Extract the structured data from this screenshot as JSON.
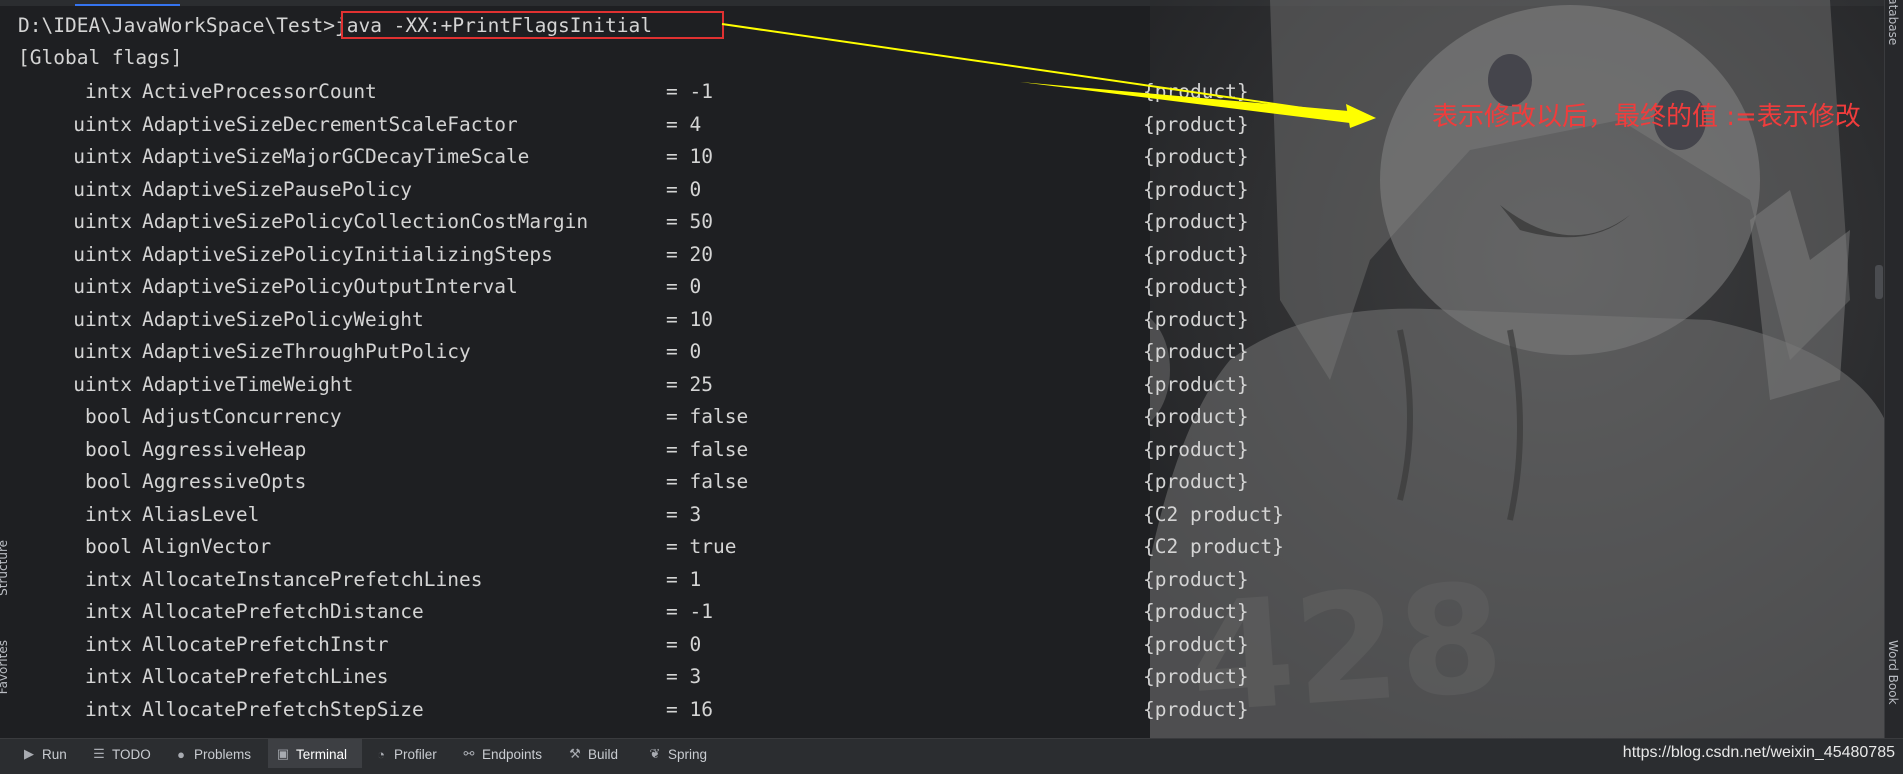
{
  "terminal": {
    "prompt": "D:\\IDEA\\JavaWorkSpace\\Test>",
    "command": "java -XX:+PrintFlagsInitial",
    "header": "[Global flags]",
    "flags": [
      {
        "type": "intx",
        "name": "ActiveProcessorCount",
        "value": "-1",
        "origin": "{product}"
      },
      {
        "type": "uintx",
        "name": "AdaptiveSizeDecrementScaleFactor",
        "value": "4",
        "origin": "{product}"
      },
      {
        "type": "uintx",
        "name": "AdaptiveSizeMajorGCDecayTimeScale",
        "value": "10",
        "origin": "{product}"
      },
      {
        "type": "uintx",
        "name": "AdaptiveSizePausePolicy",
        "value": "0",
        "origin": "{product}"
      },
      {
        "type": "uintx",
        "name": "AdaptiveSizePolicyCollectionCostMargin",
        "value": "50",
        "origin": "{product}"
      },
      {
        "type": "uintx",
        "name": "AdaptiveSizePolicyInitializingSteps",
        "value": "20",
        "origin": "{product}"
      },
      {
        "type": "uintx",
        "name": "AdaptiveSizePolicyOutputInterval",
        "value": "0",
        "origin": "{product}"
      },
      {
        "type": "uintx",
        "name": "AdaptiveSizePolicyWeight",
        "value": "10",
        "origin": "{product}"
      },
      {
        "type": "uintx",
        "name": "AdaptiveSizeThroughPutPolicy",
        "value": "0",
        "origin": "{product}"
      },
      {
        "type": "uintx",
        "name": "AdaptiveTimeWeight",
        "value": "25",
        "origin": "{product}"
      },
      {
        "type": "bool",
        "name": "AdjustConcurrency",
        "value": "false",
        "origin": "{product}"
      },
      {
        "type": "bool",
        "name": "AggressiveHeap",
        "value": "false",
        "origin": "{product}"
      },
      {
        "type": "bool",
        "name": "AggressiveOpts",
        "value": "false",
        "origin": "{product}"
      },
      {
        "type": "intx",
        "name": "AliasLevel",
        "value": "3",
        "origin": "{C2 product}"
      },
      {
        "type": "bool",
        "name": "AlignVector",
        "value": "true",
        "origin": "{C2 product}"
      },
      {
        "type": "intx",
        "name": "AllocateInstancePrefetchLines",
        "value": "1",
        "origin": "{product}"
      },
      {
        "type": "intx",
        "name": "AllocatePrefetchDistance",
        "value": "-1",
        "origin": "{product}"
      },
      {
        "type": "intx",
        "name": "AllocatePrefetchInstr",
        "value": "0",
        "origin": "{product}"
      },
      {
        "type": "intx",
        "name": "AllocatePrefetchLines",
        "value": "3",
        "origin": "{product}"
      },
      {
        "type": "intx",
        "name": "AllocatePrefetchStepSize",
        "value": "16",
        "origin": "{product}"
      }
    ]
  },
  "annotation": {
    "text": "表示修改以后，最终的值 :=表示修改",
    "color": "#f03c3c",
    "arrow_color": "#ffff00",
    "box_color": "#e03131"
  },
  "bottom_bar": {
    "tabs": [
      {
        "id": "run",
        "label": "Run",
        "icon": "play-icon",
        "glyph": "▶",
        "active": false
      },
      {
        "id": "todo",
        "label": "TODO",
        "icon": "list-icon",
        "glyph": "☰",
        "active": false
      },
      {
        "id": "problems",
        "label": "Problems",
        "icon": "warning-icon",
        "glyph": "●",
        "active": false
      },
      {
        "id": "terminal",
        "label": "Terminal",
        "icon": "terminal-icon",
        "glyph": "▣",
        "active": true
      },
      {
        "id": "profiler",
        "label": "Profiler",
        "icon": "profiler-icon",
        "glyph": "◔",
        "active": false
      },
      {
        "id": "endpoints",
        "label": "Endpoints",
        "icon": "endpoints-icon",
        "glyph": "⚯",
        "active": false
      },
      {
        "id": "build",
        "label": "Build",
        "icon": "hammer-icon",
        "glyph": "⚒",
        "active": false
      },
      {
        "id": "spring",
        "label": "Spring",
        "icon": "spring-leaf-icon",
        "glyph": "❦",
        "active": false
      }
    ]
  },
  "side_panels": {
    "right_top": "Database",
    "right_bottom": "Word Book",
    "left_top": "Structure",
    "left_bottom": "Favorites"
  },
  "watermark": "https://blog.csdn.net/weixin_45480785"
}
